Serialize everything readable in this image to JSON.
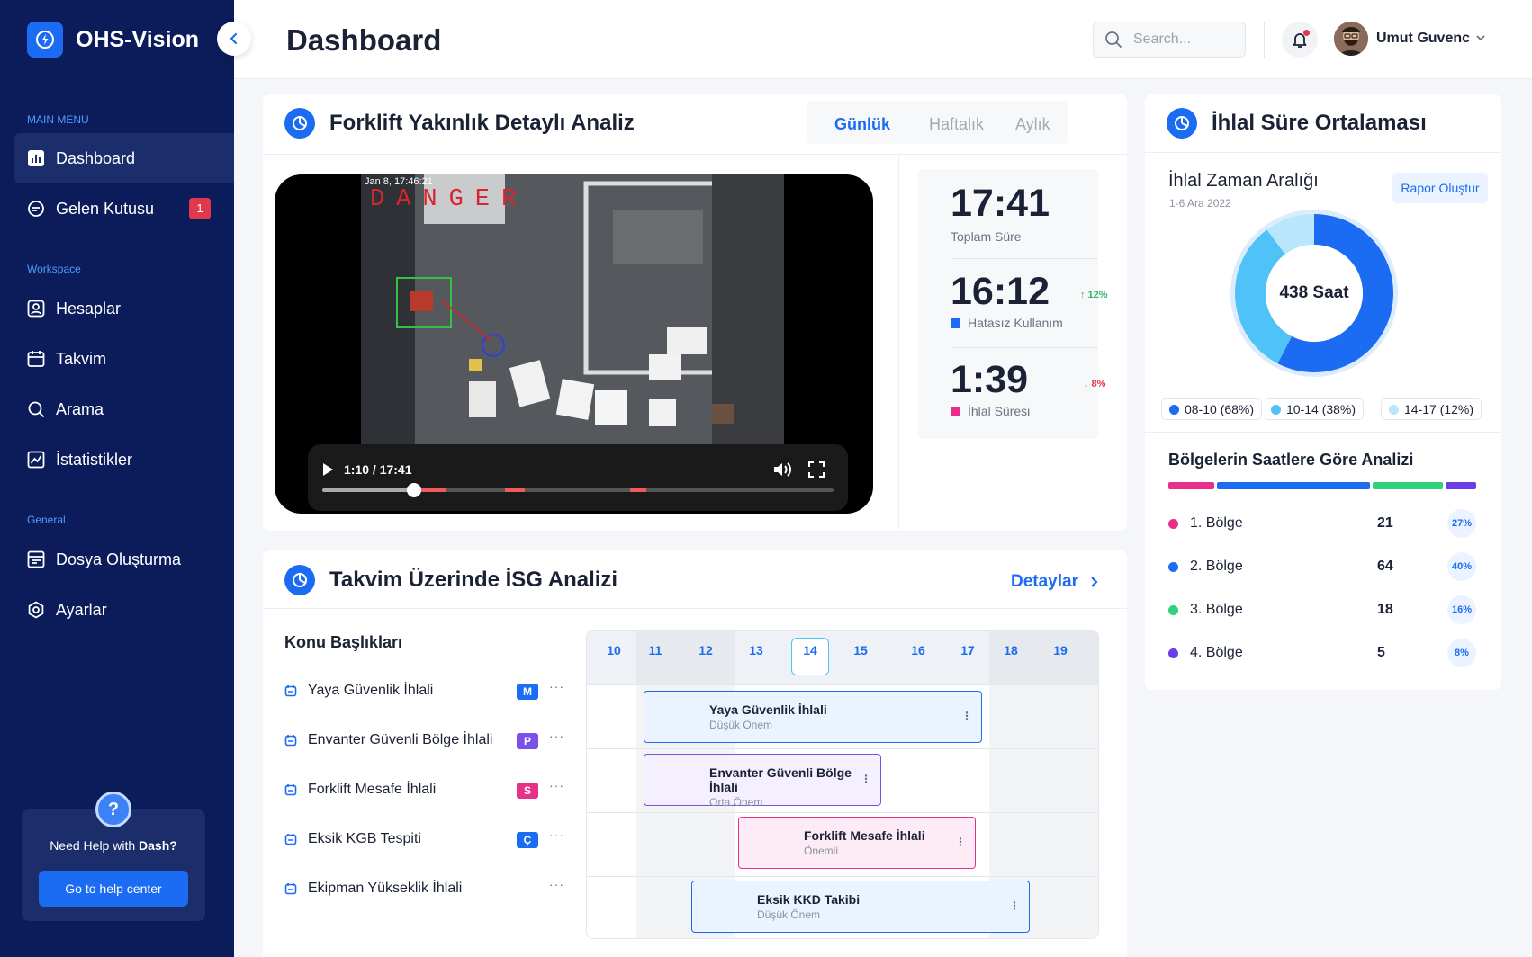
{
  "app": {
    "name": "OHS-Vision"
  },
  "sidebar": {
    "main_label": "MAIN MENU",
    "main_items": [
      {
        "label": "Dashboard",
        "icon": "dashboard-icon"
      },
      {
        "label": "Gelen Kutusu",
        "icon": "inbox-icon",
        "badge": "1"
      }
    ],
    "workspace_label": "Workspace",
    "workspace_items": [
      {
        "label": "Hesaplar",
        "icon": "accounts-icon"
      },
      {
        "label": "Takvim",
        "icon": "calendar-icon"
      },
      {
        "label": "Arama",
        "icon": "search-icon"
      },
      {
        "label": "İstatistikler",
        "icon": "statistics-icon"
      }
    ],
    "general_label": "General",
    "general_items": [
      {
        "label": "Dosya Oluşturma",
        "icon": "file-icon"
      },
      {
        "label": "Ayarlar",
        "icon": "settings-icon"
      }
    ],
    "help": {
      "text": "Need Help with ",
      "brand": "Dash?",
      "button": "Go to help center"
    }
  },
  "header": {
    "title": "Dashboard",
    "search_placeholder": "Search...",
    "user_name": "Umut Guvenc"
  },
  "forklift": {
    "title": "Forklift Yakınlık Detaylı Analiz",
    "tabs": [
      "Günlük",
      "Haftalık",
      "Aylık"
    ],
    "active_tab": "Günlük",
    "video": {
      "overlay_time": "Jan 8, 17:46:21",
      "overlay_alert": "DANGER",
      "time": "1:10 / 17:41",
      "progress": 0.18
    },
    "stats": [
      {
        "value": "17:41",
        "label": "Toplam Süre"
      },
      {
        "value": "16:12",
        "label": "Hatasız Kullanım",
        "trend": "↑ 12%",
        "color": "#1b6cf2"
      },
      {
        "value": "1:39",
        "label": "İhlal Süresi",
        "trend": "↓ 8%",
        "color": "#e8308a"
      }
    ]
  },
  "calendar": {
    "title": "Takvim Üzerinde İSG Analizi",
    "details_link": "Detaylar",
    "topics_header": "Konu Başlıkları",
    "topics": [
      {
        "label": "Yaya Güvenlik İhlali",
        "badge": "M",
        "badge_color": "#1b6cf2"
      },
      {
        "label": "Envanter Güvenli Bölge İhlali",
        "badge": "P",
        "badge_color": "#7b4fe8"
      },
      {
        "label": "Forklift Mesafe İhlali",
        "badge": "S",
        "badge_color": "#e8308a"
      },
      {
        "label": "Eksik KGB Tespiti",
        "badge": "Ç",
        "badge_color": "#1b6cf2"
      },
      {
        "label": "Ekipman Yükseklik İhlali",
        "badge": "",
        "badge_color": ""
      }
    ],
    "days": [
      "10",
      "11",
      "12",
      "13",
      "14",
      "15",
      "16",
      "17",
      "18",
      "19"
    ],
    "selected_day": "14",
    "events": [
      {
        "title": "Yaya Güvenlik İhlali",
        "priority": "Düşük Önem",
        "color": "#1b6cf2",
        "bg": "#eaf3ff"
      },
      {
        "title": "Envanter Güvenli Bölge İhlali",
        "priority": "Orta Önem",
        "color": "#7b4fe8",
        "bg": "#f4f0ff"
      },
      {
        "title": "Forklift Mesafe İhlali",
        "priority": "Önemli",
        "color": "#e8308a",
        "bg": "#fdecf5"
      },
      {
        "title": "Eksik KKD Takibi",
        "priority": "Düşük Önem",
        "color": "#1b6cf2",
        "bg": "#eaf3ff"
      }
    ]
  },
  "violations": {
    "title": "İhlal Süre Ortalaması",
    "subtitle": "İhlal Zaman Aralığı",
    "date_range": "1-6 Ara 2022",
    "report_button": "Rapor Oluştur",
    "donut_center": "438 Saat",
    "legend": [
      {
        "label": "08-10 (68%)",
        "color": "#1b6cf2"
      },
      {
        "label": "10-14 (38%)",
        "color": "#4fc3f7"
      },
      {
        "label": "14-17 (12%)",
        "color": "#b9e6fb"
      }
    ],
    "regions_title": "Bölgelerin Saatlere Göre Analizi",
    "regions": [
      {
        "name": "1. Bölge",
        "value": "21",
        "pct": "27%",
        "color": "#e8308a"
      },
      {
        "name": "2. Bölge",
        "value": "64",
        "pct": "40%",
        "color": "#1b6cf2"
      },
      {
        "name": "3. Bölge",
        "value": "18",
        "pct": "16%",
        "color": "#2fd27a"
      },
      {
        "name": "4. Bölge",
        "value": "5",
        "pct": "8%",
        "color": "#6a3de8"
      }
    ]
  },
  "chart_data": {
    "type": "pie",
    "title": "İhlal Zaman Aralığı",
    "categories": [
      "08-10",
      "10-14",
      "14-17"
    ],
    "values": [
      68,
      38,
      12
    ],
    "center_label": "438 Saat"
  }
}
